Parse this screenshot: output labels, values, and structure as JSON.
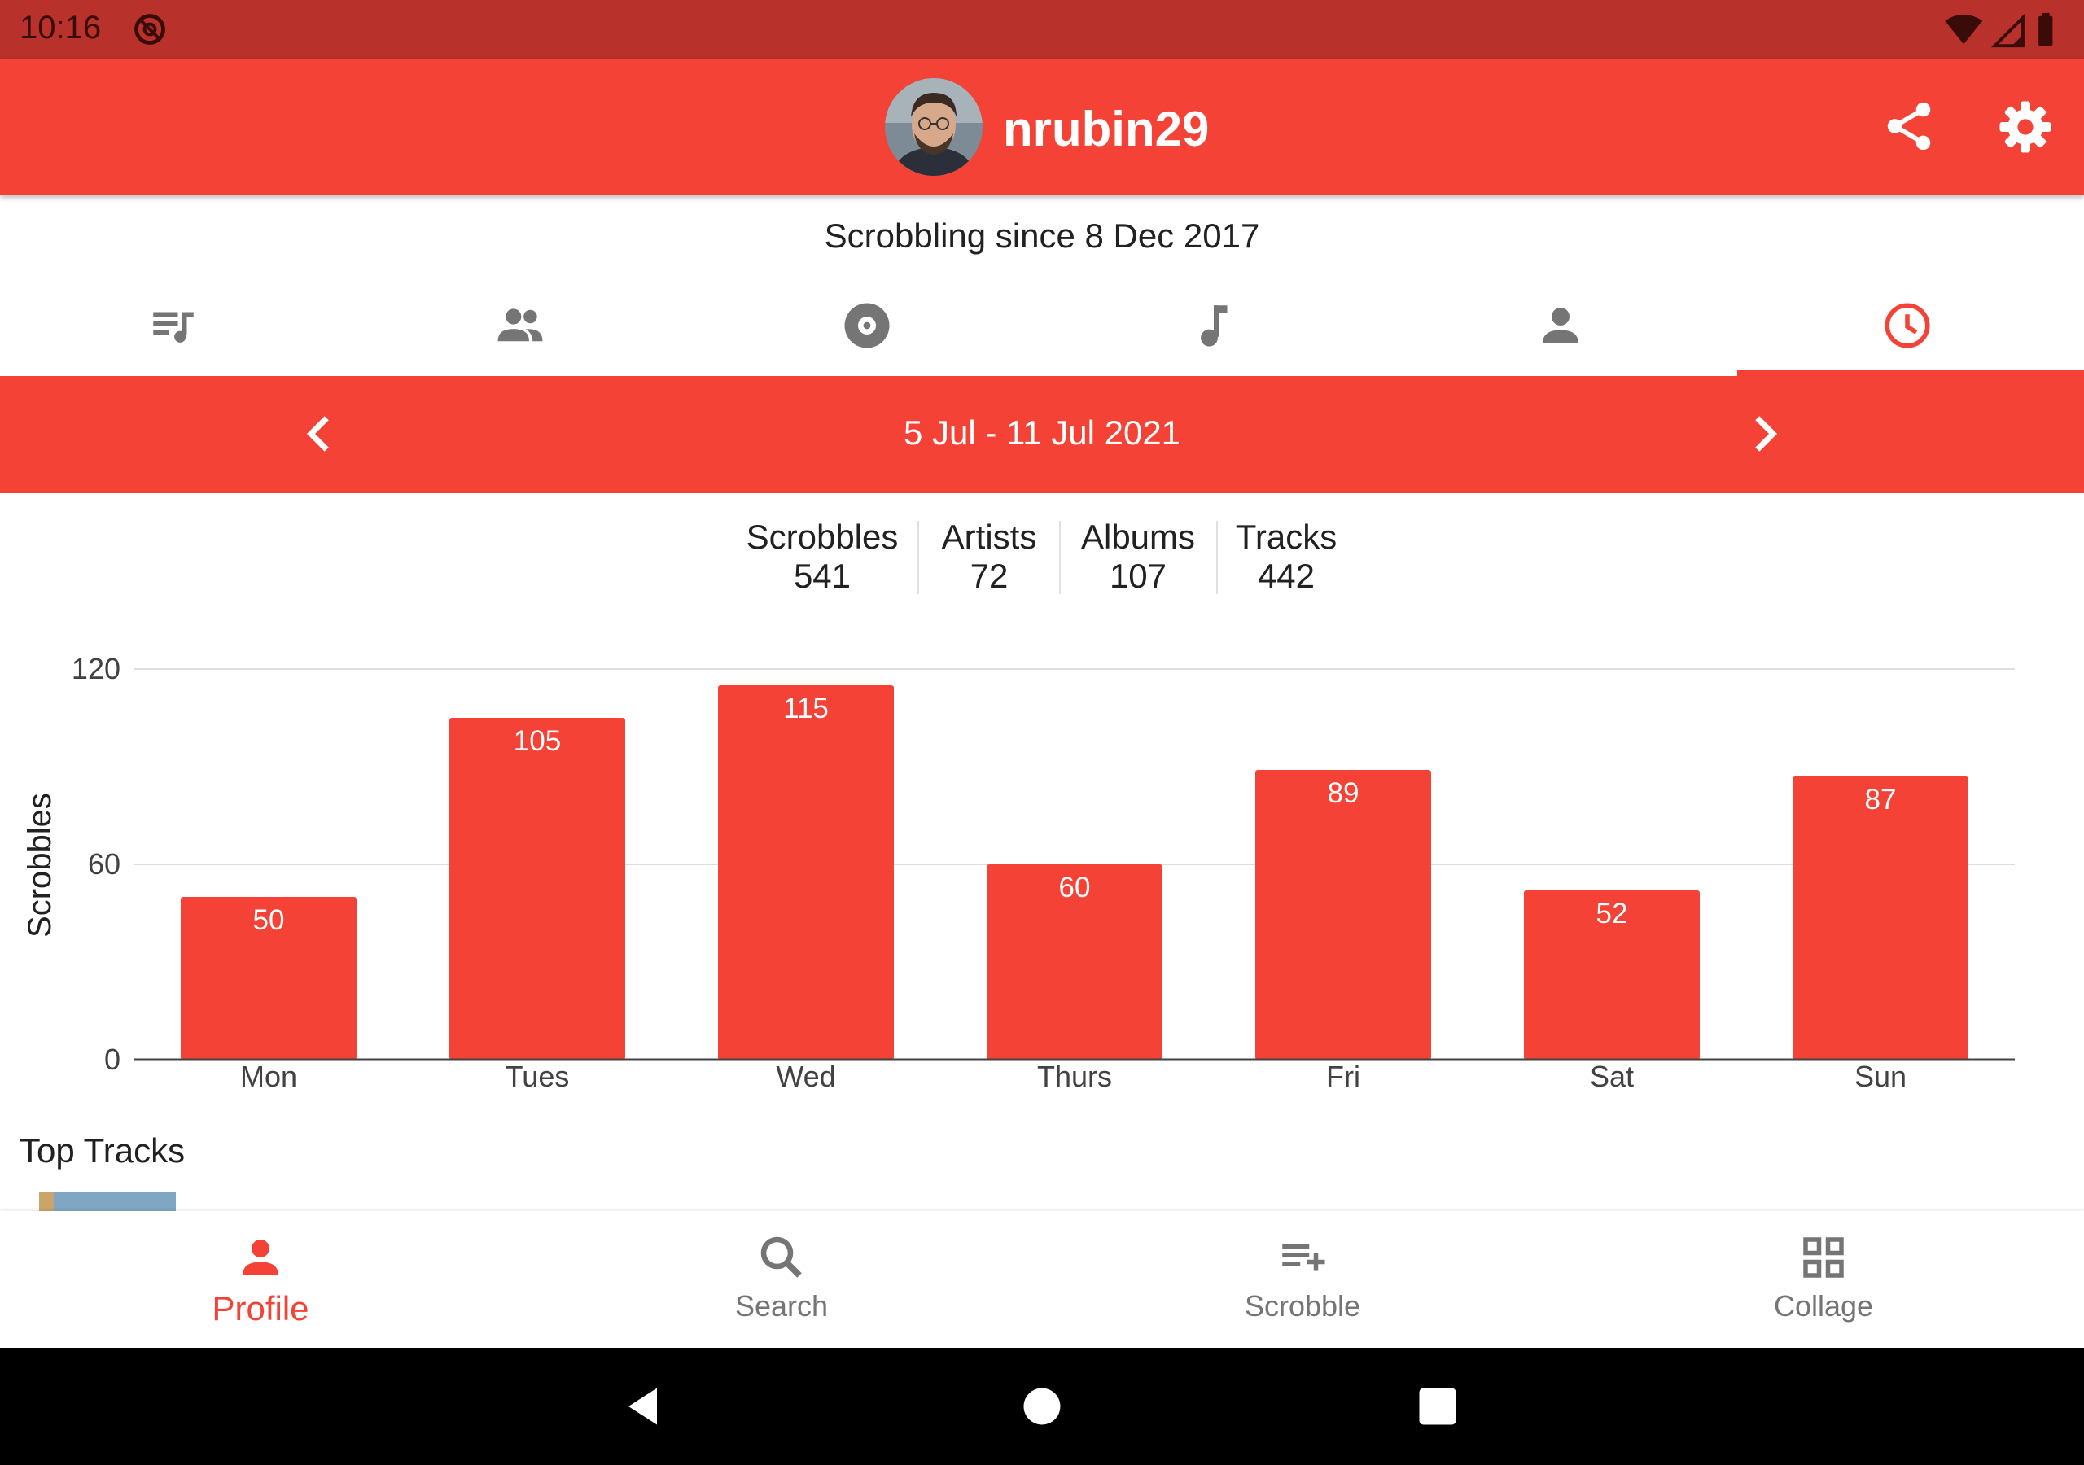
{
  "status_bar": {
    "time": "10:16"
  },
  "header": {
    "username": "nrubin29",
    "share_icon": "share-icon",
    "settings_icon": "settings-icon"
  },
  "subtitle": "Scrobbling since 8 Dec 2017",
  "tabs": [
    {
      "name": "tracks",
      "icon": "playlist-music-icon",
      "active": false
    },
    {
      "name": "friends",
      "icon": "people-icon",
      "active": false
    },
    {
      "name": "albums",
      "icon": "album-icon",
      "active": false
    },
    {
      "name": "music",
      "icon": "music-note-icon",
      "active": false
    },
    {
      "name": "artists",
      "icon": "person-icon",
      "active": false
    },
    {
      "name": "weekly",
      "icon": "clock-icon",
      "active": true
    }
  ],
  "period": {
    "label": "5 Jul - 11 Jul 2021"
  },
  "stats": [
    {
      "label": "Scrobbles",
      "value": "541"
    },
    {
      "label": "Artists",
      "value": "72"
    },
    {
      "label": "Albums",
      "value": "107"
    },
    {
      "label": "Tracks",
      "value": "442"
    }
  ],
  "chart_data": {
    "type": "bar",
    "categories": [
      "Mon",
      "Tues",
      "Wed",
      "Thurs",
      "Fri",
      "Sat",
      "Sun"
    ],
    "values": [
      50,
      105,
      115,
      60,
      89,
      52,
      87
    ],
    "ylabel": "Scrobbles",
    "yticks": [
      0,
      60,
      120
    ],
    "ylim": [
      0,
      120
    ],
    "grid": true,
    "bar_color": "#f44336"
  },
  "top_tracks_heading": "Top Tracks",
  "bottom_nav": [
    {
      "label": "Profile",
      "icon": "person-icon",
      "active": true
    },
    {
      "label": "Search",
      "icon": "search-icon",
      "active": false
    },
    {
      "label": "Scrobble",
      "icon": "playlist-add-icon",
      "active": false
    },
    {
      "label": "Collage",
      "icon": "grid-icon",
      "active": false
    }
  ],
  "colors": {
    "accent": "#f44336",
    "status_bar": "#b8312a",
    "inactive": "#757575"
  }
}
